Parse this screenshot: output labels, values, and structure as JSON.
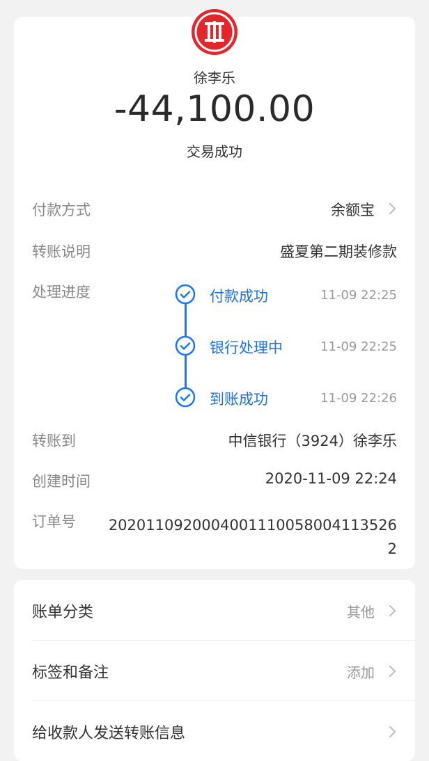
{
  "header": {
    "logo_icon": "citic-bank-logo",
    "payee": "徐李乐",
    "amount": "-44,100.00",
    "status": "交易成功"
  },
  "details": {
    "payment_method": {
      "label": "付款方式",
      "value": "余额宝"
    },
    "transfer_note": {
      "label": "转账说明",
      "value": "盛夏第二期装修款"
    },
    "progress": {
      "label": "处理进度",
      "steps": [
        {
          "label": "付款成功",
          "time": "11-09 22:25"
        },
        {
          "label": "银行处理中",
          "time": "11-09 22:25"
        },
        {
          "label": "到账成功",
          "time": "11-09 22:26"
        }
      ]
    },
    "transfer_to": {
      "label": "转账到",
      "value": "中信银行（3924）徐李乐"
    },
    "created_time": {
      "label": "创建时间",
      "value": "2020-11-09 22:24"
    },
    "order_no": {
      "label": "订单号",
      "value": "20201109200040011100580041135262"
    }
  },
  "actions": {
    "bill_category": {
      "label": "账单分类",
      "value": "其他"
    },
    "tags_notes": {
      "label": "标签和备注",
      "value": "添加"
    },
    "send_message": {
      "label": "给收款人发送转账信息"
    }
  },
  "colors": {
    "accent_blue": "#1677ff",
    "logo_red": "#e3262b",
    "background": "#f2f2f3"
  }
}
